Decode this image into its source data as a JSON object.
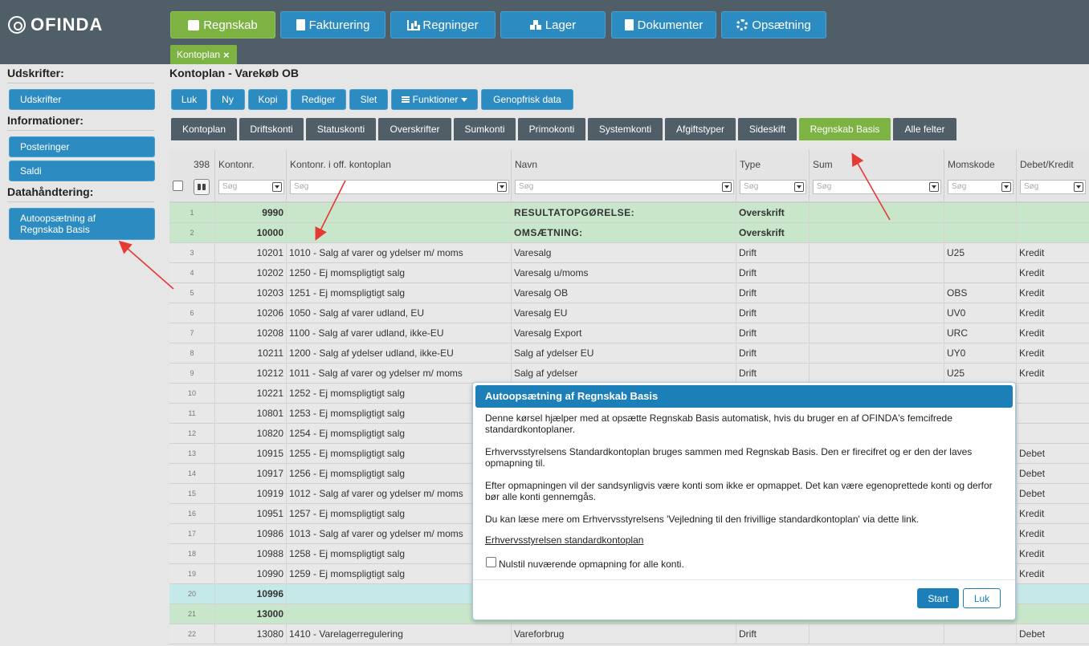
{
  "brand": "OFINDA",
  "nav": {
    "items": [
      {
        "label": "Regnskab",
        "icon": "calendar-icon",
        "active": true
      },
      {
        "label": "Fakturering",
        "icon": "clipboard-icon",
        "active": false
      },
      {
        "label": "Regninger",
        "icon": "bar-chart-icon",
        "active": false
      },
      {
        "label": "Lager",
        "icon": "cubes-icon",
        "active": false
      },
      {
        "label": "Dokumenter",
        "icon": "document-icon",
        "active": false
      },
      {
        "label": "Opsætning",
        "icon": "gear-icon",
        "active": false
      }
    ],
    "subtab": {
      "label": "Kontoplan",
      "close": "×"
    }
  },
  "sidebar": {
    "udskrifter_head": "Udskrifter:",
    "udskrifter_btn": "Udskrifter",
    "info_head": "Informationer:",
    "posteringer_btn": "Posteringer",
    "saldi_btn": "Saldi",
    "data_head": "Datahåndtering:",
    "auto_btn_line1": "Autoopsætning af",
    "auto_btn_line2": "Regnskab Basis"
  },
  "page": {
    "title": "Kontoplan - Varekøb OB"
  },
  "toolbar": {
    "luk": "Luk",
    "ny": "Ny",
    "kopi": "Kopi",
    "rediger": "Rediger",
    "slet": "Slet",
    "funktioner": "Funktioner",
    "genopfrisk": "Genopfrisk data"
  },
  "views": {
    "tabs": [
      "Kontoplan",
      "Driftskonti",
      "Statuskonti",
      "Overskrifter",
      "Sumkonti",
      "Primokonti",
      "Systemkonti",
      "Afgiftstyper",
      "Sideskift",
      "Regnskab Basis",
      "Alle felter"
    ],
    "active": "Regnskab Basis"
  },
  "table": {
    "count": "398",
    "columns": {
      "kontonr": "Kontonr.",
      "off": "Kontonr. i off. kontoplan",
      "navn": "Navn",
      "type": "Type",
      "sum": "Sum",
      "moms": "Momskode",
      "debkred": "Debet/Kredit"
    },
    "filter_placeholder": "Søg",
    "rows": [
      {
        "n": "1",
        "kto": "9990",
        "off": "",
        "navn": "RESULTATOPGØRELSE:",
        "type": "Overskrift",
        "moms": "",
        "dk": "",
        "style": "green"
      },
      {
        "n": "2",
        "kto": "10000",
        "off": "",
        "navn": "OMSÆTNING:",
        "type": "Overskrift",
        "moms": "",
        "dk": "",
        "style": "green"
      },
      {
        "n": "3",
        "kto": "10201",
        "off": "1010 - Salg af varer og ydelser m/ moms",
        "navn": "Varesalg",
        "type": "Drift",
        "moms": "U25",
        "dk": "Kredit",
        "style": ""
      },
      {
        "n": "4",
        "kto": "10202",
        "off": "1250 - Ej momspligtigt salg",
        "navn": "Varesalg u/moms",
        "type": "Drift",
        "moms": "",
        "dk": "Kredit",
        "style": ""
      },
      {
        "n": "5",
        "kto": "10203",
        "off": "1251 - Ej momspligtigt salg",
        "navn": "Varesalg OB",
        "type": "Drift",
        "moms": "OBS",
        "dk": "Kredit",
        "style": ""
      },
      {
        "n": "6",
        "kto": "10206",
        "off": "1050 - Salg af varer udland, EU",
        "navn": "Varesalg EU",
        "type": "Drift",
        "moms": "UV0",
        "dk": "Kredit",
        "style": ""
      },
      {
        "n": "7",
        "kto": "10208",
        "off": "1100 - Salg af varer udland, ikke-EU",
        "navn": "Varesalg Export",
        "type": "Drift",
        "moms": "URC",
        "dk": "Kredit",
        "style": ""
      },
      {
        "n": "8",
        "kto": "10211",
        "off": "1200 - Salg af ydelser udland, ikke-EU",
        "navn": "Salg af ydelser EU",
        "type": "Drift",
        "moms": "UY0",
        "dk": "Kredit",
        "style": ""
      },
      {
        "n": "9",
        "kto": "10212",
        "off": "1011 - Salg af varer og ydelser m/ moms",
        "navn": "Salg af ydelser",
        "type": "Drift",
        "moms": "U25",
        "dk": "Kredit",
        "style": ""
      },
      {
        "n": "10",
        "kto": "10221",
        "off": "1252 - Ej momspligtigt salg",
        "navn": "",
        "type": "",
        "moms": "",
        "dk": "",
        "style": ""
      },
      {
        "n": "11",
        "kto": "10801",
        "off": "1253 - Ej momspligtigt salg",
        "navn": "",
        "type": "",
        "moms": "",
        "dk": "",
        "style": ""
      },
      {
        "n": "12",
        "kto": "10820",
        "off": "1254 - Ej momspligtigt salg",
        "navn": "",
        "type": "",
        "moms": "",
        "dk": "",
        "style": ""
      },
      {
        "n": "13",
        "kto": "10915",
        "off": "1255 - Ej momspligtigt salg",
        "navn": "",
        "type": "",
        "moms": "",
        "dk": "Debet",
        "style": ""
      },
      {
        "n": "14",
        "kto": "10917",
        "off": "1256 - Ej momspligtigt salg",
        "navn": "",
        "type": "",
        "moms": "",
        "dk": "Debet",
        "style": ""
      },
      {
        "n": "15",
        "kto": "10919",
        "off": "1012 - Salg af varer og ydelser m/ moms",
        "navn": "",
        "type": "",
        "moms": "",
        "dk": "Debet",
        "style": ""
      },
      {
        "n": "16",
        "kto": "10951",
        "off": "1257 - Ej momspligtigt salg",
        "navn": "",
        "type": "",
        "moms": "",
        "dk": "Kredit",
        "style": ""
      },
      {
        "n": "17",
        "kto": "10986",
        "off": "1013 - Salg af varer og ydelser m/ moms",
        "navn": "",
        "type": "",
        "moms": "",
        "dk": "Kredit",
        "style": ""
      },
      {
        "n": "18",
        "kto": "10988",
        "off": "1258 - Ej momspligtigt salg",
        "navn": "",
        "type": "",
        "moms": "",
        "dk": "Kredit",
        "style": ""
      },
      {
        "n": "19",
        "kto": "10990",
        "off": "1259 - Ej momspligtigt salg",
        "navn": "",
        "type": "",
        "moms": "",
        "dk": "Kredit",
        "style": ""
      },
      {
        "n": "20",
        "kto": "10996",
        "off": "",
        "navn": "",
        "type": "",
        "moms": "",
        "dk": "",
        "style": "teal"
      },
      {
        "n": "21",
        "kto": "13000",
        "off": "",
        "navn": "",
        "type": "",
        "moms": "",
        "dk": "",
        "style": "green"
      },
      {
        "n": "22",
        "kto": "13080",
        "off": "1410 - Varelagerregulering",
        "navn": "Vareforbrug",
        "type": "Drift",
        "moms": "",
        "dk": "Debet",
        "style": ""
      }
    ]
  },
  "dialog": {
    "title": "Autoopsætning af Regnskab Basis",
    "p1": "Denne kørsel hjælper med at opsætte Regnskab Basis automatisk, hvis du bruger en af OFINDA's femcifrede standardkontoplaner.",
    "p2": "Erhvervsstyrelsens Standardkontoplan bruges sammen med Regnskab Basis. Den er firecifret og er den der laves opmapning til.",
    "p3": "Efter opmapningen vil der sandsynligvis være konti som ikke er opmappet. Det kan være egenoprettede konti og derfor bør alle konti gennemgås.",
    "p4": "Du kan læse mere om Erhvervsstyrelsens 'Vejledning til den frivillige standardkontoplan' via dette link.",
    "link": "Erhvervsstyrelsen standardkontoplan",
    "checkbox_label": "Nulstil nuværende opmapning for alle konti.",
    "start": "Start",
    "close": "Luk"
  }
}
